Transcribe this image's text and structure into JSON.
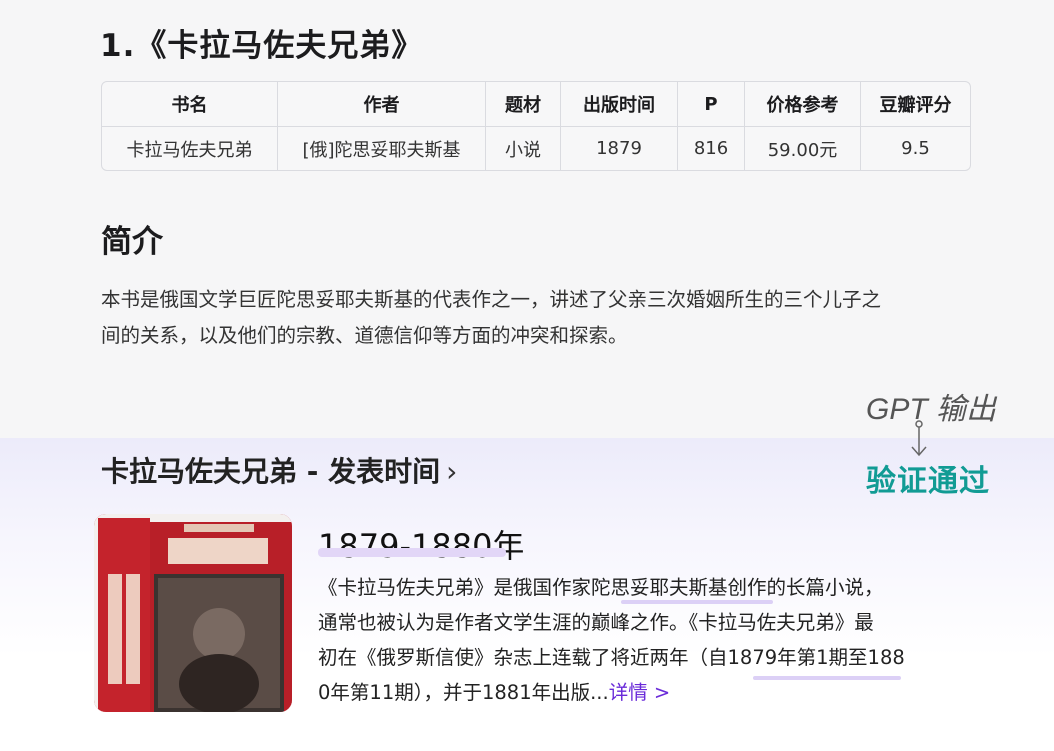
{
  "section_title": "1.《卡拉马佐夫兄弟》",
  "table": {
    "headers": [
      "书名",
      "作者",
      "题材",
      "出版时间",
      "P",
      "价格参考",
      "豆瓣评分"
    ],
    "row": [
      "卡拉马佐夫兄弟",
      "[俄]陀思妥耶夫斯基",
      "小说",
      "1879",
      "816",
      "59.00元",
      "9.5"
    ]
  },
  "intro": {
    "heading": "简介",
    "line1": "本书是俄国文学巨匠陀思妥耶夫斯基的代表作之一，讲述了父亲三次婚姻所生的三个儿子之",
    "line2": "间的关系，以及他们的宗教、道德信仰等方面的冲突和探索。"
  },
  "annotation": {
    "gpt_label": "GPT 输出",
    "verified_label": "验证通过",
    "verified_color": "#119b94"
  },
  "card": {
    "title": "卡拉马佐夫兄弟 - 发表时间",
    "chevron": "›",
    "date": "1879-1880年",
    "desc_line1": "《卡拉马佐夫兄弟》是俄国作家陀思妥耶夫斯基创作的长篇小说，",
    "desc_line2": "通常也被认为是作者文学生涯的巅峰之作。《卡拉马佐夫兄弟》最",
    "desc_line3": "初在《俄罗斯信使》杂志上连载了将近两年（自1879年第1期至188",
    "desc_line4": "0年第11期），并于1881年出版...",
    "more_link": "详情 >",
    "link_color": "#6a2bd9",
    "cover_icon": "book-cover-image",
    "cover_text": "卡拉马佐夫兄弟"
  }
}
